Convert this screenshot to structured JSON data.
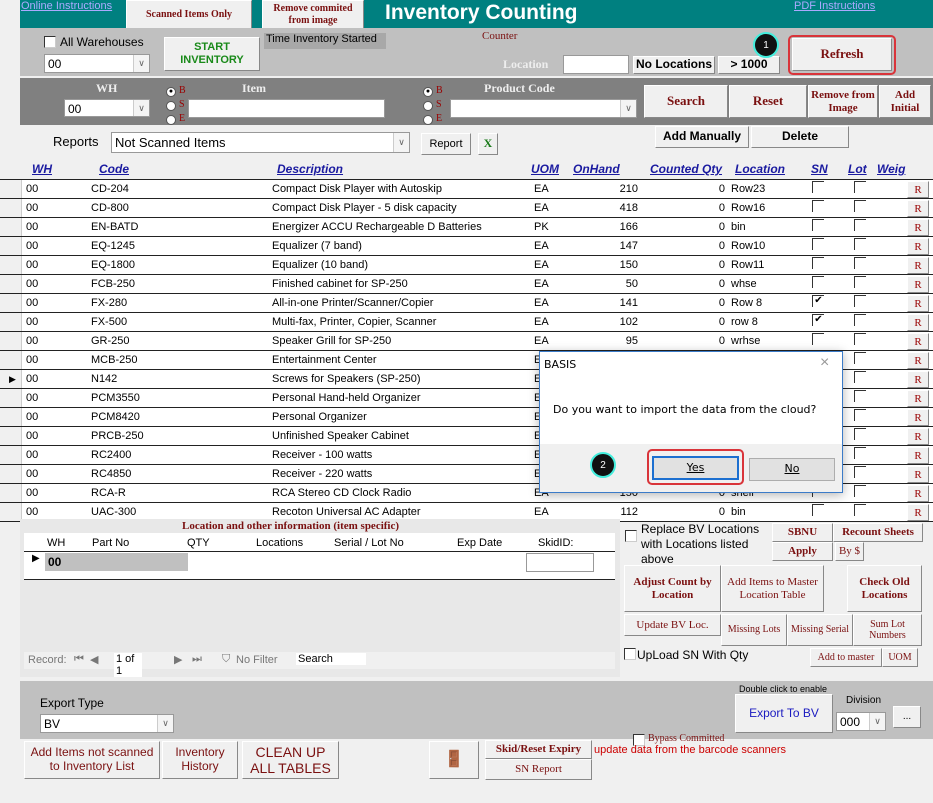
{
  "header": {
    "title": "Inventory Counting",
    "online_instructions": "Online Instructions",
    "pdf_instructions": "PDF Instructions",
    "scanned_items_only": "Scanned Items Only",
    "remove_commited": "Remove commited from image"
  },
  "top": {
    "all_warehouses": "All Warehouses",
    "warehouse_value": "00",
    "start_inventory": "START INVENTORY",
    "time_started": "Time Inventory Started",
    "counter": "Counter",
    "location_label": "Location",
    "location_value": "",
    "no_locations": "No Locations",
    "gt1000": "> 1000",
    "refresh": "Refresh",
    "badge1": "1"
  },
  "search": {
    "wh_label": "WH",
    "wh_value": "00",
    "item_label": "Item",
    "product_code_label": "Product Code",
    "radio_b": "B",
    "radio_s": "S",
    "radio_e": "E",
    "search": "Search",
    "reset": "Reset",
    "remove_from_image": "Remove from Image",
    "add_initial": "Add Initial"
  },
  "reports": {
    "label": "Reports",
    "value": "Not Scanned Items",
    "report_button": "Report",
    "excel_icon": "excel-icon",
    "add_manually": "Add Manually",
    "delete": "Delete"
  },
  "grid": {
    "columns": [
      "WH",
      "Code",
      "Description",
      "UOM",
      "OnHand",
      "Counted Qty",
      "Location",
      "SN",
      "Lot",
      "Weig"
    ],
    "r_label": "R",
    "rows": [
      {
        "wh": "00",
        "code": "CD-204",
        "desc": "Compact Disk Player with Autoskip",
        "uom": "EA",
        "onhand": "210",
        "counted": "0",
        "loc": "Row23",
        "sn": false
      },
      {
        "wh": "00",
        "code": "CD-800",
        "desc": "Compact Disk Player - 5 disk capacity",
        "uom": "EA",
        "onhand": "418",
        "counted": "0",
        "loc": "Row16",
        "sn": false
      },
      {
        "wh": "00",
        "code": "EN-BATD",
        "desc": "Energizer ACCU Rechargeable D Batteries",
        "uom": "PK",
        "onhand": "166",
        "counted": "0",
        "loc": "bin",
        "sn": false
      },
      {
        "wh": "00",
        "code": "EQ-1245",
        "desc": "Equalizer (7 band)",
        "uom": "EA",
        "onhand": "147",
        "counted": "0",
        "loc": "Row10",
        "sn": false
      },
      {
        "wh": "00",
        "code": "EQ-1800",
        "desc": "Equalizer (10 band)",
        "uom": "EA",
        "onhand": "150",
        "counted": "0",
        "loc": "Row11",
        "sn": false
      },
      {
        "wh": "00",
        "code": "FCB-250",
        "desc": "Finished cabinet for SP-250",
        "uom": "EA",
        "onhand": "50",
        "counted": "0",
        "loc": "whse",
        "sn": false
      },
      {
        "wh": "00",
        "code": "FX-280",
        "desc": "All-in-one Printer/Scanner/Copier",
        "uom": "EA",
        "onhand": "141",
        "counted": "0",
        "loc": "Row 8",
        "sn": true
      },
      {
        "wh": "00",
        "code": "FX-500",
        "desc": "Multi-fax, Printer, Copier, Scanner",
        "uom": "EA",
        "onhand": "102",
        "counted": "0",
        "loc": "row 8",
        "sn": true
      },
      {
        "wh": "00",
        "code": "GR-250",
        "desc": "Speaker Grill for SP-250",
        "uom": "EA",
        "onhand": "95",
        "counted": "0",
        "loc": "wrhse",
        "sn": false
      },
      {
        "wh": "00",
        "code": "MCB-250",
        "desc": "Entertainment Center",
        "uom": "EA",
        "onhand": "",
        "counted": "",
        "loc": "",
        "sn": false
      },
      {
        "wh": "00",
        "code": "N142",
        "desc": "Screws for Speakers (SP-250)",
        "uom": "EA",
        "onhand": "",
        "counted": "",
        "loc": "",
        "sn": false,
        "current": true
      },
      {
        "wh": "00",
        "code": "PCM3550",
        "desc": "Personal Hand-held Organizer",
        "uom": "EA",
        "onhand": "",
        "counted": "",
        "loc": "",
        "sn": false
      },
      {
        "wh": "00",
        "code": "PCM8420",
        "desc": "Personal Organizer",
        "uom": "EA",
        "onhand": "",
        "counted": "",
        "loc": "",
        "sn": false
      },
      {
        "wh": "00",
        "code": "PRCB-250",
        "desc": "Unfinished Speaker Cabinet",
        "uom": "EA",
        "onhand": "",
        "counted": "",
        "loc": "",
        "sn": false
      },
      {
        "wh": "00",
        "code": "RC2400",
        "desc": "Receiver - 100 watts",
        "uom": "EA",
        "onhand": "",
        "counted": "",
        "loc": "",
        "sn": false
      },
      {
        "wh": "00",
        "code": "RC4850",
        "desc": "Receiver - 220 watts",
        "uom": "EA",
        "onhand": "",
        "counted": "",
        "loc": "",
        "sn": false
      },
      {
        "wh": "00",
        "code": "RCA-R",
        "desc": "RCA Stereo CD Clock Radio",
        "uom": "EA",
        "onhand": "150",
        "counted": "0",
        "loc": "shelf",
        "sn": false
      },
      {
        "wh": "00",
        "code": "UAC-300",
        "desc": "Recoton Universal AC Adapter",
        "uom": "EA",
        "onhand": "112",
        "counted": "0",
        "loc": "bin",
        "sn": false
      }
    ]
  },
  "sub": {
    "title": "Location and other information (item specific)",
    "columns": [
      "WH",
      "Part No",
      "QTY",
      "Locations",
      "Serial / Lot No",
      "Exp Date",
      "SkidID:"
    ],
    "row_wh": "00",
    "record_label": "Record:",
    "record_value": "1 of 1",
    "no_filter": "No Filter",
    "search": "Search"
  },
  "right": {
    "replace_bv": "Replace BV Locations with Locations listed above",
    "sbnu": "SBNU",
    "recount": "Recount Sheets",
    "apply": "Apply",
    "by_dollar": "By $",
    "adjust": "Adjust Count by Location",
    "add_master": "Add Items to Master Location Table",
    "check_old": "Check Old Locations",
    "update_bv": "Update BV Loc.",
    "missing_lots": "Missing Lots",
    "missing_serial": "Missing Serial",
    "sum_lot": "Sum Lot Numbers",
    "upload_sn": "UpLoad SN With Qty",
    "add_to_master": "Add to master",
    "uom": "UOM"
  },
  "bottom": {
    "export_type_label": "Export Type",
    "export_type_value": "BV",
    "double_click": "Double click to enable",
    "export_bv": "Export To BV",
    "division_label": "Division",
    "division_value": "000",
    "ellipsis": "...",
    "add_not_scanned": "Add Items not scanned to Inventory List",
    "history": "Inventory History",
    "clean_up": "CLEAN UP ALL TABLES",
    "skid_reset": "Skid/Reset Expiry",
    "sn_report": "SN Report",
    "bypass": "Bypass Committed",
    "update_note": "update data from the barcode scanners"
  },
  "dialog": {
    "title": "BASIS",
    "message": "Do you want to import the data from the cloud?",
    "yes": "Yes",
    "no": "No",
    "badge2": "2"
  },
  "colors": {
    "teal": "#008080",
    "accent_red": "#d9343a",
    "dark_red": "#7a1010",
    "link_blue": "#1a1aa0"
  }
}
